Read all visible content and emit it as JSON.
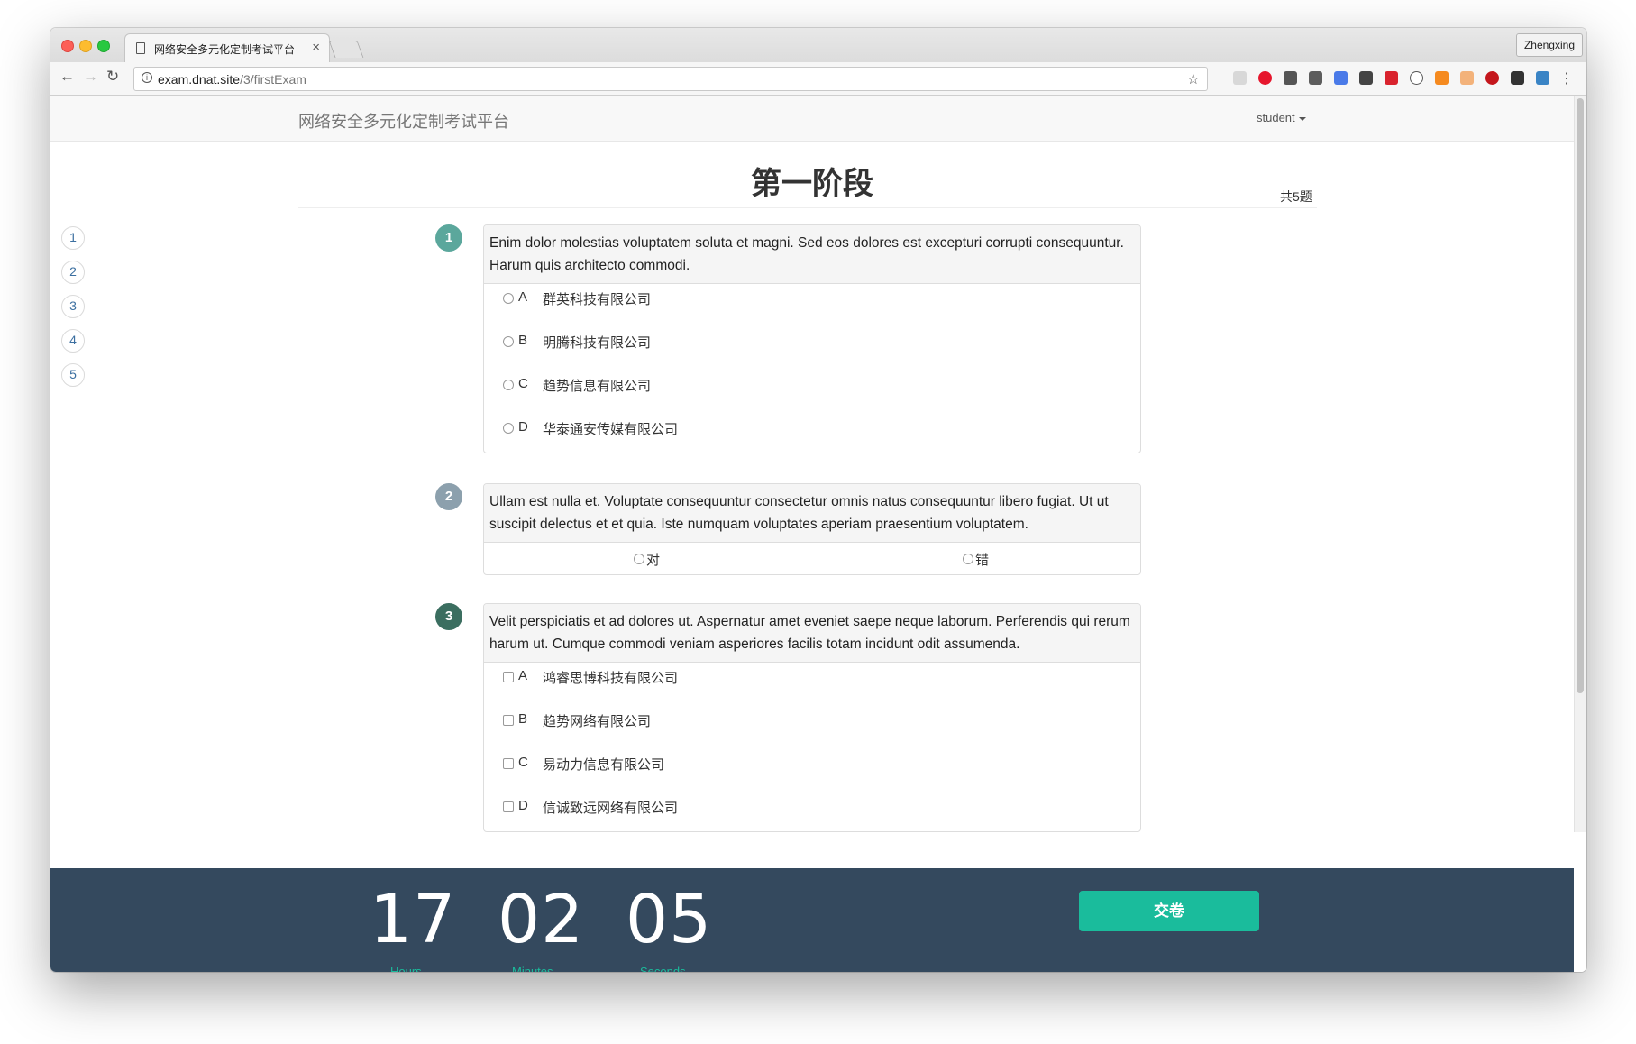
{
  "browser": {
    "tab_title": "网络安全多元化定制考试平台",
    "tab_close": "×",
    "profile_name": "Zhengxing",
    "url_host": "exam.dnat.site",
    "url_path": "/3/firstExam"
  },
  "navbar": {
    "brand": "网络安全多元化定制考试平台",
    "user": "student"
  },
  "exam": {
    "stage_title": "第一阶段",
    "total": "共5题",
    "nav_numbers": [
      "1",
      "2",
      "3",
      "4",
      "5"
    ],
    "questions": [
      {
        "number": "1",
        "badge_color": "#5ba79c",
        "text": "Enim dolor molestias voluptatem soluta et magni. Sed eos dolores est excepturi corrupti consequuntur. Harum quis architecto commodi.",
        "type": "single",
        "options": [
          {
            "letter": "A",
            "text": "群英科技有限公司"
          },
          {
            "letter": "B",
            "text": "明腾科技有限公司"
          },
          {
            "letter": "C",
            "text": "趋势信息有限公司"
          },
          {
            "letter": "D",
            "text": "华泰通安传媒有限公司"
          }
        ]
      },
      {
        "number": "2",
        "badge_color": "#8ca0ad",
        "text": "Ullam est nulla et. Voluptate consequuntur consectetur omnis natus consequuntur libero fugiat. Ut ut suscipit delectus et et quia. Iste numquam voluptates aperiam praesentium voluptatem.",
        "type": "judge",
        "true_label": "对",
        "false_label": "错"
      },
      {
        "number": "3",
        "badge_color": "#3b6e60",
        "text": "Velit perspiciatis et ad dolores ut. Aspernatur amet eveniet saepe neque laborum. Perferendis qui rerum harum ut. Cumque commodi veniam asperiores facilis totam incidunt odit assumenda.",
        "type": "multiple",
        "options": [
          {
            "letter": "A",
            "text": "鸿睿思博科技有限公司"
          },
          {
            "letter": "B",
            "text": "趋势网络有限公司"
          },
          {
            "letter": "C",
            "text": "易动力信息有限公司"
          },
          {
            "letter": "D",
            "text": "信诚致远网络有限公司"
          }
        ]
      }
    ]
  },
  "timer": {
    "hours": "17",
    "minutes": "02",
    "seconds": "05",
    "hours_label": "Hours",
    "minutes_label": "Minutes",
    "seconds_label": "Seconds"
  },
  "submit_label": "交卷",
  "colors": {
    "footer": "#34495e",
    "accent": "#1abc9c"
  }
}
